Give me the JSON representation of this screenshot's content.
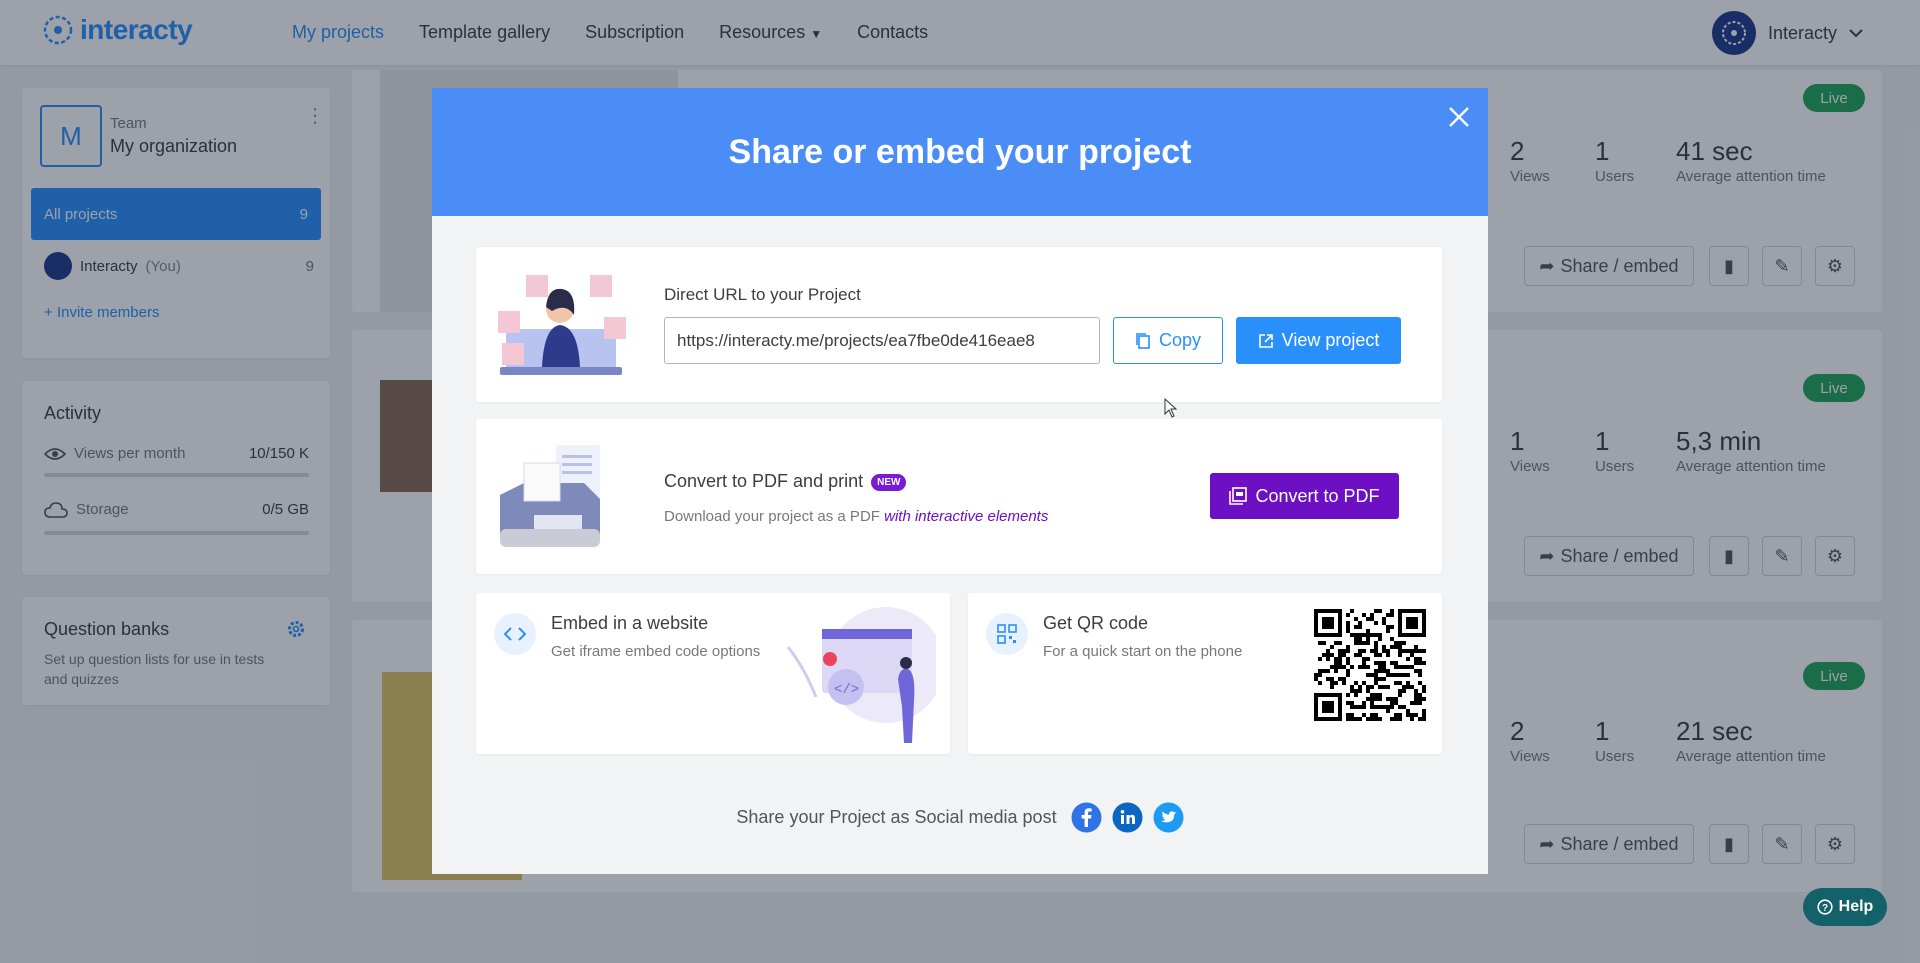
{
  "app": {
    "logo_text": "interacty",
    "user_name": "Interacty"
  },
  "nav": {
    "my_projects": "My projects",
    "template_gallery": "Template gallery",
    "subscription": "Subscription",
    "resources": "Resources",
    "contacts": "Contacts"
  },
  "sidebar": {
    "team_initial": "M",
    "team_label": "Team",
    "org_name": "My organization",
    "all_projects": "All projects",
    "all_projects_count": "9",
    "member_name": "Interacty",
    "member_you": "(You)",
    "member_count": "9",
    "invite": "Invite members",
    "activity_title": "Activity",
    "views_label": "Views per month",
    "views_value": "10/150 K",
    "views_fraction": 0.0001,
    "storage_label": "Storage",
    "storage_value": "0/5 GB",
    "storage_fraction": 0,
    "qb_title": "Question banks",
    "qb_desc": "Set up question lists for use in tests and quizzes"
  },
  "projects": [
    {
      "status": "Live",
      "views": "2",
      "views_label": "Views",
      "users": "1",
      "users_label": "Users",
      "attention": "41 sec",
      "attention_label": "Average attention time",
      "share": "Share / embed"
    },
    {
      "status": "Live",
      "views": "1",
      "views_label": "Views",
      "users": "1",
      "users_label": "Users",
      "attention": "5,3 min",
      "attention_label": "Average attention time",
      "share": "Share / embed"
    },
    {
      "status": "Live",
      "views": "2",
      "views_label": "Views",
      "users": "1",
      "users_label": "Users",
      "attention": "21 sec",
      "attention_label": "Average attention time",
      "share": "Share / embed"
    }
  ],
  "modal": {
    "title": "Share or embed your project",
    "url_title": "Direct URL to your Project",
    "url_value": "https://interacty.me/projects/ea7fbe0de416eae8",
    "copy": "Copy",
    "view": "View project",
    "pdf_title": "Convert to PDF and print",
    "pdf_badge": "NEW",
    "pdf_desc": "Download your project as a PDF",
    "pdf_desc_em": "with interactive elements",
    "pdf_button": "Convert to PDF",
    "embed_title": "Embed in a website",
    "embed_desc": "Get iframe embed code options",
    "qr_title": "Get QR code",
    "qr_desc": "For a quick start on the phone",
    "social": "Share your Project as Social media post"
  },
  "help": "Help",
  "colors": {
    "accent": "#2990fb",
    "header": "#4b8df6",
    "pdf": "#6d0fc2",
    "live": "#22a559"
  }
}
